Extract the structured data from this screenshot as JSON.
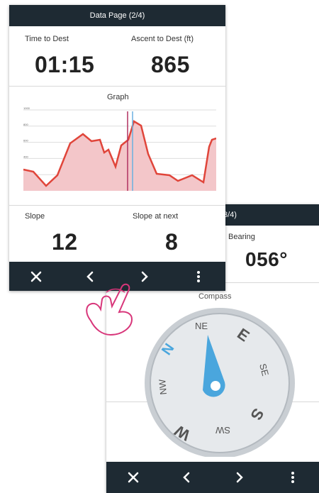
{
  "screen_front": {
    "title": "Data Page (2/4)",
    "fields": [
      {
        "label": "Time to Dest",
        "value": "01:15"
      },
      {
        "label": "Ascent to Dest (ft)",
        "value": "865"
      },
      {
        "label": "Slope",
        "value": "12"
      },
      {
        "label": "Slope at next",
        "value": "8"
      }
    ],
    "graph": {
      "title": "Graph",
      "y_ticks": [
        "1000",
        "800",
        "600",
        "400",
        "200"
      ]
    }
  },
  "screen_back": {
    "title_fragment": "3/4)",
    "bearing": {
      "label": "Bearing",
      "value": "056°"
    },
    "compass": {
      "title": "Compass",
      "labels": [
        "N",
        "NE",
        "E",
        "SE",
        "S",
        "SW",
        "W",
        "NW"
      ]
    }
  },
  "toolbar_icons": [
    "close-icon",
    "chevron-left-icon",
    "chevron-right-icon",
    "more-vertical-icon"
  ],
  "colors": {
    "bar": "#1e2a33",
    "graph_line": "#e0453a",
    "graph_fill": "#f3c6c9",
    "compass_needle": "#4aa6dd",
    "hand": "#d8367a"
  }
}
